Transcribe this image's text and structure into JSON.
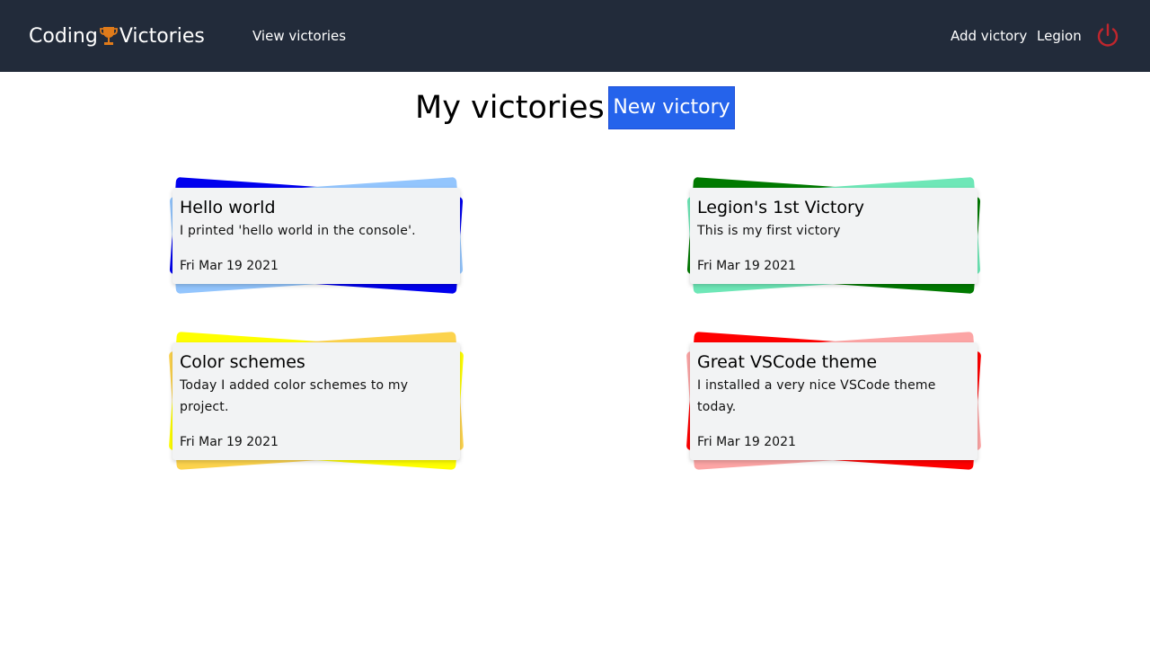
{
  "navbar": {
    "brand_left": "Coding",
    "brand_right": "Victories",
    "brand_icon": "trophy-icon",
    "view_victories": "View victories",
    "add_victory": "Add victory",
    "user": "Legion",
    "logout_icon": "power-icon",
    "colors": {
      "background": "#222b3a",
      "trophy": "#e07b1a",
      "power": "#c0262d"
    }
  },
  "header": {
    "title": "My victories",
    "new_button": "New victory",
    "button_color": "#2563eb"
  },
  "victories": [
    {
      "title": "Hello world",
      "text": "I printed 'hello world in the console'.",
      "date": "Fri Mar 19 2021",
      "color_a": "#0000ee",
      "color_b": "#93c5fd"
    },
    {
      "title": "Legion's 1st Victory",
      "text": "This is my first victory",
      "date": "Fri Mar 19 2021",
      "color_a": "#007a00",
      "color_b": "#6ee7b7"
    },
    {
      "title": "Color schemes",
      "text": "Today I added color schemes to my project.",
      "date": "Fri Mar 19 2021",
      "color_a": "#ffff00",
      "color_b": "#fcd34d"
    },
    {
      "title": "Great VSCode theme",
      "text": "I installed a very nice VSCode theme today.",
      "date": "Fri Mar 19 2021",
      "color_a": "#ff0000",
      "color_b": "#fca5a5"
    }
  ]
}
